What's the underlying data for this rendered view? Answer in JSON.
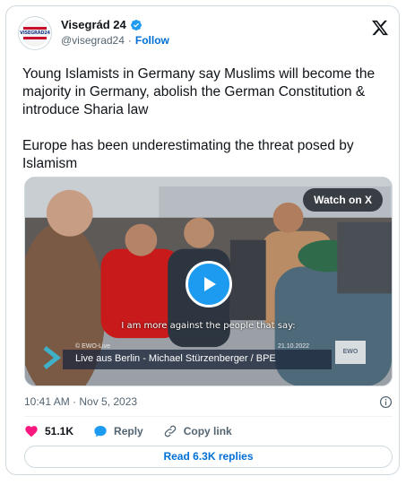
{
  "author": {
    "display_name": "Visegrád 24",
    "handle": "@visegrad24",
    "separator": "·",
    "follow_label": "Follow",
    "avatar_text": "VISEGRÁD24"
  },
  "tweet": {
    "paragraphs": [
      "Young Islamists in Germany say Muslims will become the majority in Germany, abolish the German Constitution & introduce Sharia law",
      "Europe has been underestimating the threat posed by Islamism"
    ],
    "timestamp": "10:41 AM · Nov 5, 2023"
  },
  "media": {
    "watch_label": "Watch on X",
    "subtitle": "I am more against the people that say:",
    "source": "© EWO-Live",
    "date": "21.10.2022",
    "title": "Live aus Berlin - Michael Stürzenberger /  BPE",
    "logo_text": "EWO"
  },
  "actions": {
    "like_count": "51.1K",
    "reply_label": "Reply",
    "copy_link_label": "Copy link",
    "read_replies_label": "Read 6.3K replies"
  },
  "colors": {
    "accent": "#1d9bf0",
    "link": "#006fd6",
    "like": "#f91880",
    "muted": "#536471"
  },
  "icons": [
    "verified-badge-icon",
    "x-logo-icon",
    "play-icon",
    "info-icon",
    "heart-icon",
    "reply-bubble-icon",
    "link-icon"
  ]
}
